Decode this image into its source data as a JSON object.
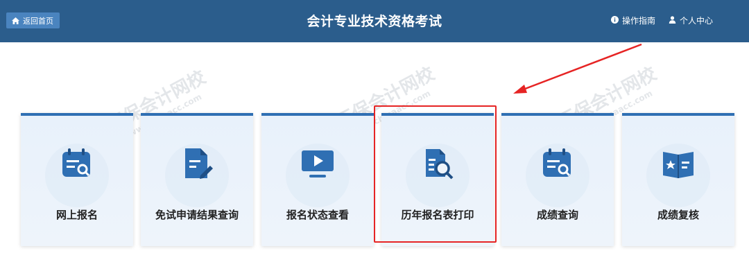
{
  "header": {
    "home_label": "返回首页",
    "title": "会计专业技术资格考试",
    "guide_label": "操作指南",
    "profile_label": "个人中心",
    "background_color": "#2b5d8c"
  },
  "watermark": {
    "text": "正保会计网校",
    "url_text": "www.chinaacc.com"
  },
  "cards": [
    {
      "label": "网上报名",
      "icon": "calendar-search-icon"
    },
    {
      "label": "免试申请结果查询",
      "icon": "document-edit-icon"
    },
    {
      "label": "报名状态查看",
      "icon": "monitor-play-icon"
    },
    {
      "label": "历年报名表打印",
      "icon": "document-search-icon",
      "highlighted": true
    },
    {
      "label": "成绩查询",
      "icon": "calendar-search-icon"
    },
    {
      "label": "成绩复核",
      "icon": "book-star-icon"
    }
  ],
  "colors": {
    "accent": "#2f6fb3",
    "highlight": "#e62424"
  }
}
